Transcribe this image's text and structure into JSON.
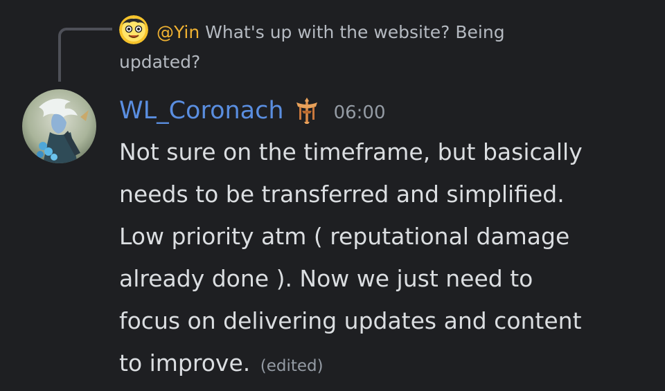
{
  "reply": {
    "author": "@Yin",
    "text": "What's up with the website? Being updated?",
    "avatar_icon": "emoji-face-avatar-icon"
  },
  "message": {
    "author": "WL_Coronach",
    "author_color": "#5a8ee0",
    "role_icon": "sword-shield-role-icon",
    "timestamp": "06:00",
    "lines": [
      "Not sure on the timeframe, but basically",
      "needs to be transferred and simplified.",
      "Low priority atm ( reputational damage",
      "already done ). Now we just need to",
      "focus on delivering updates and content",
      "to improve."
    ],
    "edited_label": "(edited)"
  },
  "colors": {
    "background": "#1e1f22",
    "reply_author": "#f0b232",
    "text": "#dbdee1",
    "muted": "#949ba4"
  }
}
